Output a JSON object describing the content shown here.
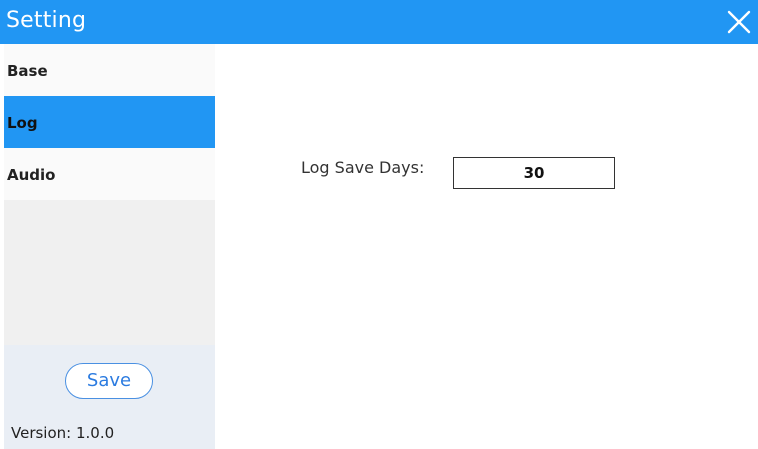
{
  "window": {
    "title": "Setting"
  },
  "sidebar": {
    "items": [
      {
        "label": "Base",
        "active": false
      },
      {
        "label": "Log",
        "active": true
      },
      {
        "label": "Audio",
        "active": false
      }
    ],
    "save_label": "Save",
    "version_text": "Version: 1.0.0"
  },
  "log_settings": {
    "save_days_label": "Log Save Days:",
    "save_days_value": "30"
  },
  "colors": {
    "accent": "#2196f3",
    "sidebar_bg": "#f0f0f0",
    "sidebar_bottom_bg": "#e9eef5"
  },
  "icons": {
    "close": "close-icon"
  }
}
